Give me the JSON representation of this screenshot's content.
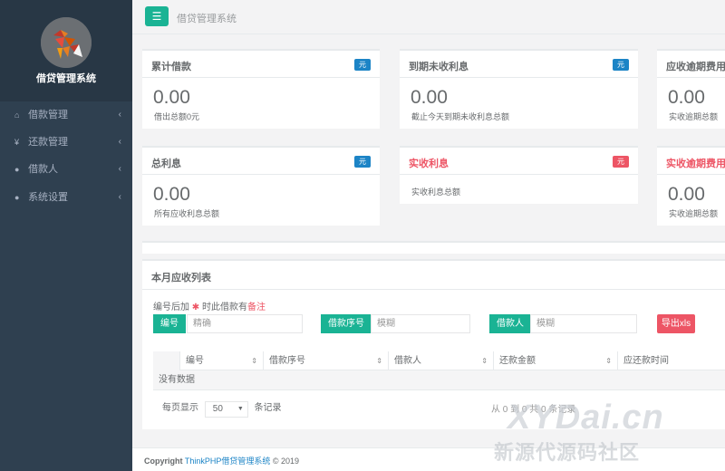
{
  "app": {
    "name": "借贷管理系统",
    "topbar_title": "借贷管理系统"
  },
  "sidebar": {
    "items": [
      {
        "label": "借款管理",
        "icon": "home-icon"
      },
      {
        "label": "还款管理",
        "icon": "yen-icon"
      },
      {
        "label": "借款人",
        "icon": "user-icon"
      },
      {
        "label": "系统设置",
        "icon": "user-icon"
      }
    ]
  },
  "cards": [
    {
      "title": "累计借款",
      "badge": "元",
      "value": "0.00",
      "sub": "借出总额0元"
    },
    {
      "title": "到期未收利息",
      "badge": "元",
      "value": "0.00",
      "sub": "截止今天到期未收利息总额"
    },
    {
      "title": "应收逾期费用",
      "value": "0.00",
      "sub": "实收逾期总额"
    },
    {
      "title": "总利息",
      "badge": "元",
      "value": "0.00",
      "sub": "所有应收利息总额"
    },
    {
      "title": "实收利息",
      "badge": "元",
      "sub": "实收利息总额"
    },
    {
      "title": "实收逾期费用",
      "value": "0.00",
      "sub": "实收逾期总额"
    }
  ],
  "list": {
    "title": "本月应收列表",
    "hint_prefix": "编号后加",
    "hint_star": "✱",
    "hint_middle": "时此借款有",
    "hint_remark": "备注",
    "filters": [
      {
        "label": "编号",
        "placeholder": "精确"
      },
      {
        "label": "借款序号",
        "placeholder": "模糊"
      },
      {
        "label": "借款人",
        "placeholder": "模糊"
      }
    ],
    "export_label": "导出xls",
    "columns": [
      "编号",
      "借款序号",
      "借款人",
      "还款金额",
      "应还款时间"
    ],
    "empty_text": "没有数据",
    "pager": {
      "prefix": "每页显示",
      "size": "50",
      "suffix": "条记录",
      "range": "从 0 到 0 共 0 条记录"
    }
  },
  "footer": {
    "copyright": "Copyright",
    "link": "ThinkPHP借贷管理系统",
    "year": "© 2019"
  },
  "watermark": {
    "line1": "XYDai.cn",
    "line2": "新源代源码社区"
  },
  "colors": {
    "sidebar": "#2f4050",
    "primary": "#1ab394",
    "blue": "#1c84c6",
    "danger": "#ed5565"
  }
}
